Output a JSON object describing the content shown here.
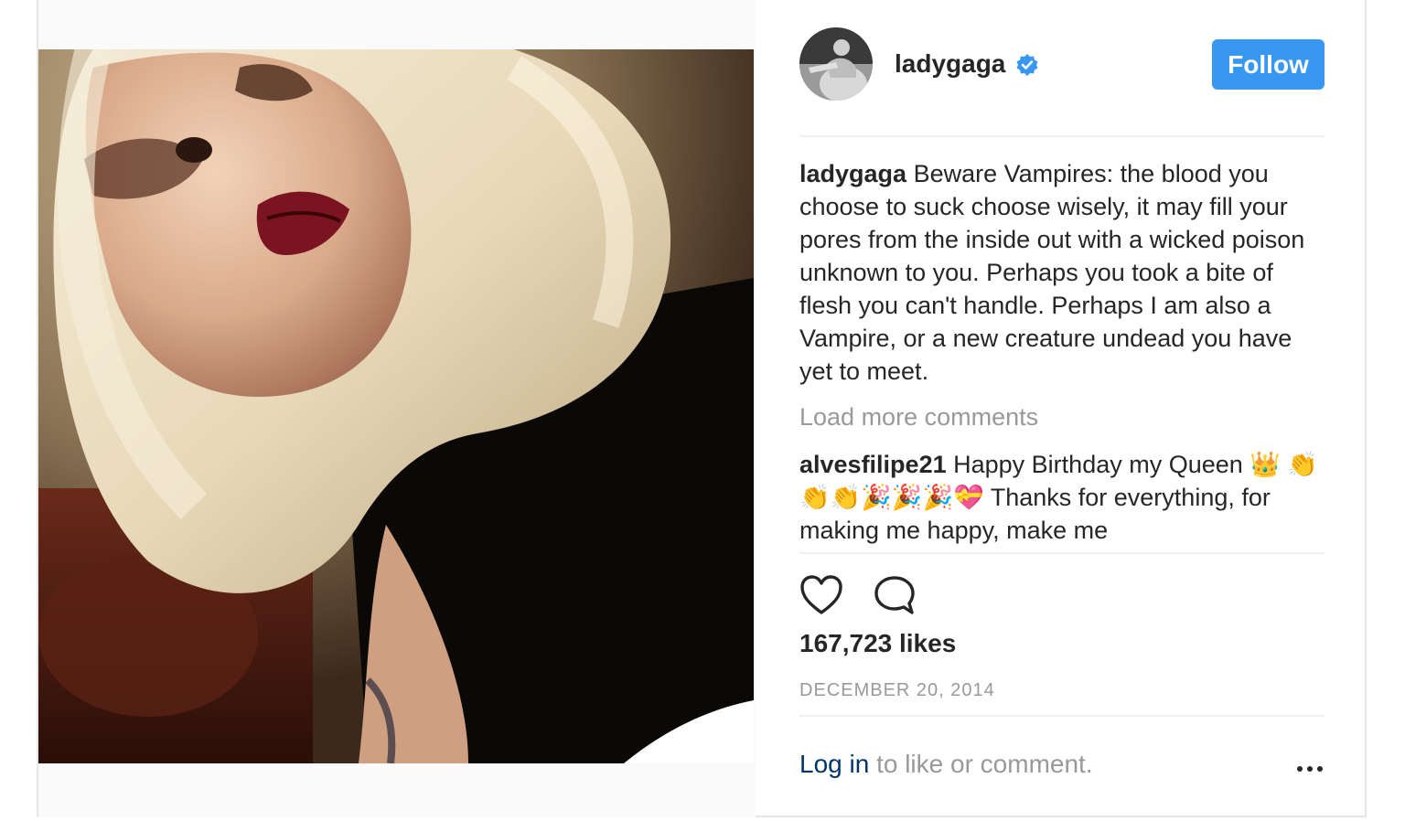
{
  "post": {
    "username": "ladygaga",
    "verified": true,
    "follow_label": "Follow",
    "caption": {
      "author": "ladygaga",
      "text": "Beware Vampires: the blood you choose to suck choose wisely, it may fill your pores from the inside out with a wicked poison unknown to you. Perhaps you took a bite of flesh you can't handle. Perhaps I am also a Vampire, or a new creature undead you have yet to meet."
    },
    "load_more_label": "Load more comments",
    "reply": {
      "author": "alvesfilipe21",
      "text": "Happy Birthday my Queen 👑 👏👏👏🎉🎉🎉💝 Thanks for everything, for making me happy, make me"
    },
    "likes": "167,723 likes",
    "date": "DECEMBER 20, 2014",
    "login": {
      "link_label": "Log in",
      "suffix": " to like or comment."
    }
  },
  "icons": {
    "like": "heart-outline-icon",
    "comment": "speech-bubble-icon",
    "verified": "verified-badge-icon",
    "more": "more-options-icon"
  },
  "colors": {
    "follow_button": "#3897f0",
    "verified_badge": "#3897f0",
    "muted_text": "#999999",
    "login_link": "#003569",
    "divider": "#efefef"
  }
}
